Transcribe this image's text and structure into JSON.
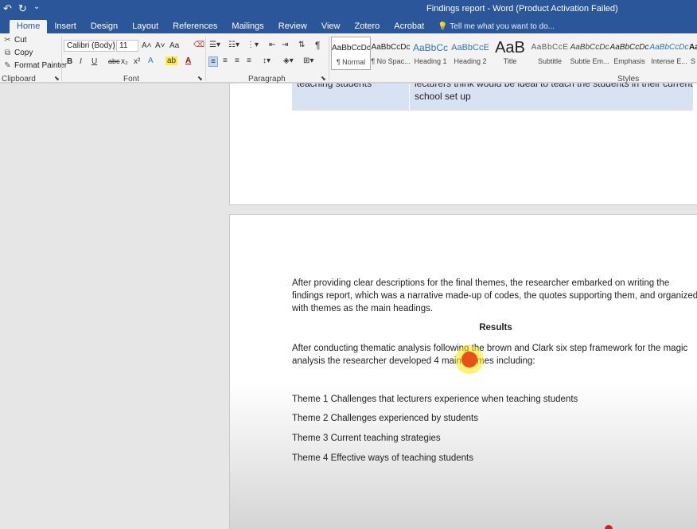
{
  "window": {
    "title": "Findings report - Word (Product Activation Failed)",
    "qat": {
      "undo_glyph": "↶",
      "redo_glyph": "↻",
      "more_glyph": "⌄"
    }
  },
  "tabs": [
    {
      "label": "Home",
      "active": true
    },
    {
      "label": "Insert"
    },
    {
      "label": "Design"
    },
    {
      "label": "Layout"
    },
    {
      "label": "References"
    },
    {
      "label": "Mailings"
    },
    {
      "label": "Review"
    },
    {
      "label": "View"
    },
    {
      "label": "Zotero"
    },
    {
      "label": "Acrobat"
    }
  ],
  "tell_me": "Tell me what you want to do...",
  "clipboard": {
    "cut": "Cut",
    "copy": "Copy",
    "format_painter": "Format Painter",
    "group_label": "Clipboard"
  },
  "font": {
    "family": "Calibri (Body)",
    "size": "11",
    "group_label": "Font",
    "bold": "B",
    "italic": "I",
    "underline": "U",
    "strike": "abc",
    "subscript": "x₂",
    "superscript": "x²",
    "grow": "A˄",
    "shrink": "A˅",
    "case": "Aa"
  },
  "paragraph": {
    "group_label": "Paragraph",
    "pilcrow": "¶"
  },
  "styles": {
    "group_label": "Styles",
    "items": [
      {
        "preview": "AaBbCcDc",
        "name": "¶ Normal"
      },
      {
        "preview": "AaBbCcDc",
        "name": "¶ No Spac..."
      },
      {
        "preview": "AaBbCc",
        "name": "Heading 1"
      },
      {
        "preview": "AaBbCcE",
        "name": "Heading 2"
      },
      {
        "preview": "AaB",
        "name": "Title"
      },
      {
        "preview": "AaBbCcE",
        "name": "Subtitle"
      },
      {
        "preview": "AaBbCcDc",
        "name": "Subtle Em..."
      },
      {
        "preview": "AaBbCcDc",
        "name": "Emphasis"
      },
      {
        "preview": "AaBbCcDc",
        "name": "Intense E..."
      },
      {
        "preview": "Aa",
        "name": "S"
      }
    ]
  },
  "document": {
    "table_row": {
      "c1_line1": "teaching students",
      "c2_line1": "lecturers think would be ideal to teach the students in their current",
      "c2_line2": "school set up"
    },
    "para1": "After providing clear descriptions for the final themes, the researcher embarked on writing the findings report, which was a narrative made-up of codes, the quotes supporting them, and organized with themes as the main headings.",
    "results_heading": "Results",
    "para2": "After conducting thematic analysis following the brown and Clark six step framework for the magic analysis the researcher developed 4 main themes including:",
    "themes": [
      "Theme 1 Challenges that lecturers experience when teaching students",
      "Theme 2 Challenges experienced by students",
      "Theme 3 Current teaching strategies",
      "Theme 4 Effective ways of teaching students"
    ]
  }
}
